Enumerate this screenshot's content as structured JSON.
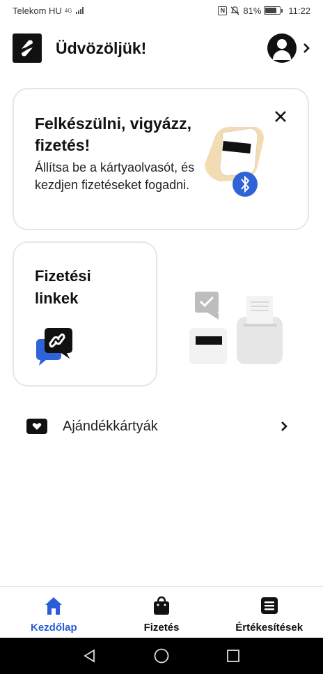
{
  "status_bar": {
    "carrier": "Telekom HU",
    "network": "4G",
    "battery_percent": "81%",
    "time": "11:22"
  },
  "header": {
    "title": "Üdvözöljük!"
  },
  "promo_card": {
    "title": "Felkészülni, vigyázz, fizetés!",
    "description": "Állítsa be a kártyaolvasót, és kezdjen fizetéseket fogadni."
  },
  "links_card": {
    "title": "Fizetési linkek"
  },
  "gift_row": {
    "label": "Ajándékkártyák"
  },
  "tabs": [
    {
      "label": "Kezdőlap",
      "icon": "home-icon",
      "active": true
    },
    {
      "label": "Fizetés",
      "icon": "shopping-bag-icon",
      "active": false
    },
    {
      "label": "Értékesítések",
      "icon": "list-icon",
      "active": false
    }
  ],
  "colors": {
    "accent": "#2b5dd6",
    "bluetooth": "#2f63d8",
    "card_border": "#e6e6e6",
    "illustration_skin": "#f3dcb4"
  }
}
